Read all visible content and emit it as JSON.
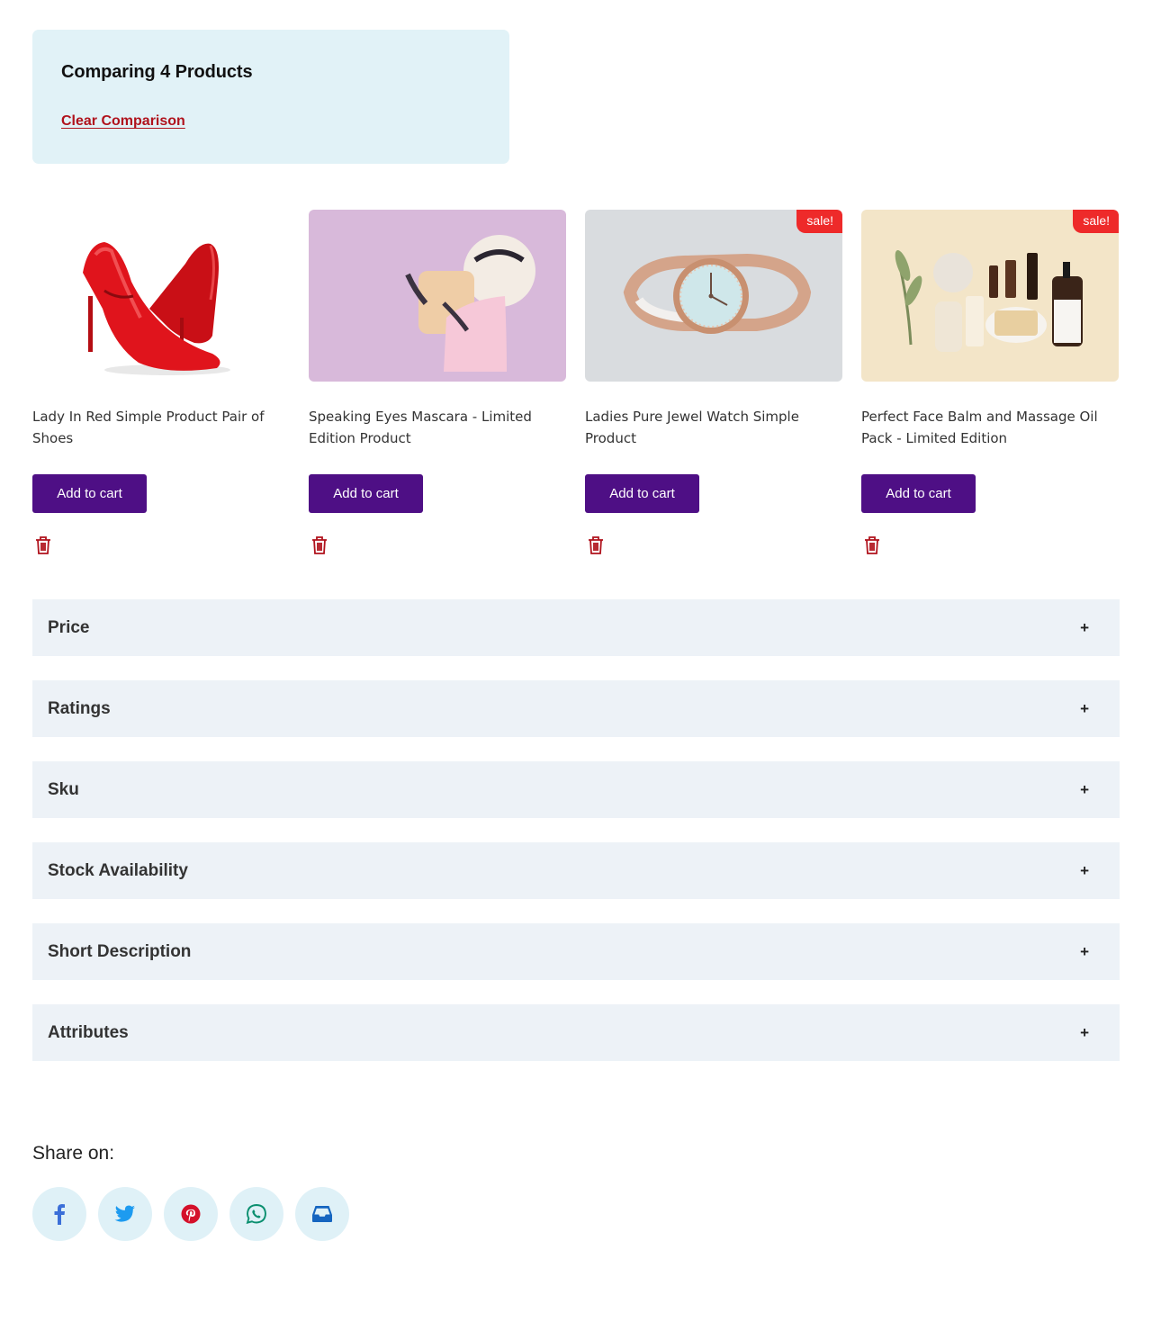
{
  "comparison": {
    "title": "Comparing 4 Products",
    "clear_label": "Clear Comparison"
  },
  "products": [
    {
      "name": "Lady In Red Simple Product Pair of Shoes",
      "cart_label": "Add to cart",
      "sale": false,
      "image": "red-heels-image"
    },
    {
      "name": "Speaking Eyes Mascara - Limited Edition Product",
      "cart_label": "Add to cart",
      "sale": false,
      "image": "eyelashes-image"
    },
    {
      "name": "Ladies Pure Jewel Watch Simple Product",
      "cart_label": "Add to cart",
      "sale": true,
      "sale_label": "sale!",
      "image": "watch-image"
    },
    {
      "name": "Perfect Face Balm and Massage Oil Pack - Limited Edition",
      "cart_label": "Add to cart",
      "sale": true,
      "sale_label": "sale!",
      "image": "cosmetics-image"
    }
  ],
  "accordion": [
    {
      "label": "Price",
      "toggle": "+"
    },
    {
      "label": "Ratings",
      "toggle": "+"
    },
    {
      "label": "Sku",
      "toggle": "+"
    },
    {
      "label": "Stock Availability",
      "toggle": "+"
    },
    {
      "label": "Short Description",
      "toggle": "+"
    },
    {
      "label": "Attributes",
      "toggle": "+"
    }
  ],
  "share": {
    "label": "Share on:",
    "icons": [
      "facebook-icon",
      "twitter-icon",
      "pinterest-icon",
      "whatsapp-icon",
      "email-inbox-icon"
    ]
  },
  "colors": {
    "accent": "#4e0f85",
    "link": "#b0121c",
    "sale": "#ee2a2a",
    "compare_bg": "#e1f2f7",
    "accordion_bg": "#edf2f7"
  }
}
